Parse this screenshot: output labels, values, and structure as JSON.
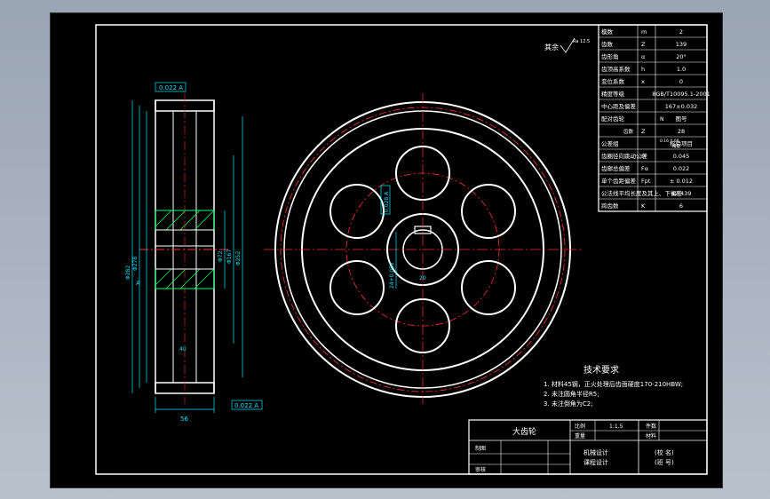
{
  "gear_params": [
    {
      "name": "模数",
      "symbol": "m",
      "value": "2"
    },
    {
      "name": "齿数",
      "symbol": "Z",
      "value": "139"
    },
    {
      "name": "齿形角",
      "symbol": "α",
      "value": "20°"
    },
    {
      "name": "齿顶高系数",
      "symbol": "h",
      "value": "1.0"
    },
    {
      "name": "变位系数",
      "symbol": "x",
      "value": "0"
    },
    {
      "name": "精度等级",
      "symbol": "",
      "value": "8GB/T10095.1-2001"
    },
    {
      "name": "中心距及偏差",
      "symbol": "",
      "value": "167±0.032"
    },
    {
      "name": "配对齿轮",
      "symbol": "",
      "value": "图号"
    },
    {
      "name": "",
      "symbol": "Z",
      "value": "28"
    },
    {
      "name": "公差组",
      "symbol": "",
      "value": "检验项目"
    },
    {
      "name": "齿圈径向跳动公差",
      "symbol": "Fr",
      "value": "0.045"
    },
    {
      "name": "齿廓总偏差",
      "symbol": "Fα",
      "value": "0.022"
    },
    {
      "name": "单个齿距偏差",
      "symbol": "Fpt",
      "value": "± 0.012"
    },
    {
      "name": "公法线平均长度及其上、下偏差",
      "symbol": "",
      "value": "42.439"
    },
    {
      "name": "跨齿数",
      "symbol": "K",
      "value": "6"
    }
  ],
  "params_extra": {
    "pair_label_teeth": "齿数",
    "pair_label_no": "代号",
    "pair_value_no": "N",
    "tolerance_sub": "0.16 0.08",
    "check_item_sub": "精度"
  },
  "tech_req": {
    "title": "技术要求",
    "items": [
      "1. 材料45钢，正火处理后齿面硬度170-210HBW;",
      "2. 未注圆角半径R5;",
      "3. 未注倒角为C2;"
    ]
  },
  "title_block": {
    "part_name": "大齿轮",
    "scale_label": "比例",
    "scale_value": "1:1.5",
    "qty_label": "件数",
    "weight_label": "重量",
    "material_label": "材料",
    "draw_label": "制图",
    "check_label": "审核",
    "course": "机械设计",
    "course2": "课程设计",
    "school": "(校 名)",
    "class_no": "(班 号)"
  },
  "annotations": {
    "runout_top": "0.022 A",
    "runout_bottom": "0.022 A",
    "dim_width": "56",
    "datum_a": "A",
    "dim_outer": "Φ282",
    "dim_root": "Φ278",
    "dim_bore": "Φ72",
    "dim_hub": "Φ167",
    "dim_web": "Φ252",
    "keyway_dim": "20",
    "bore_note": "24+0.052",
    "sym_tol": "0.028 A",
    "roughness_note": "其余",
    "roughness_value": "Ra 12.5",
    "dim_extra": "40"
  }
}
